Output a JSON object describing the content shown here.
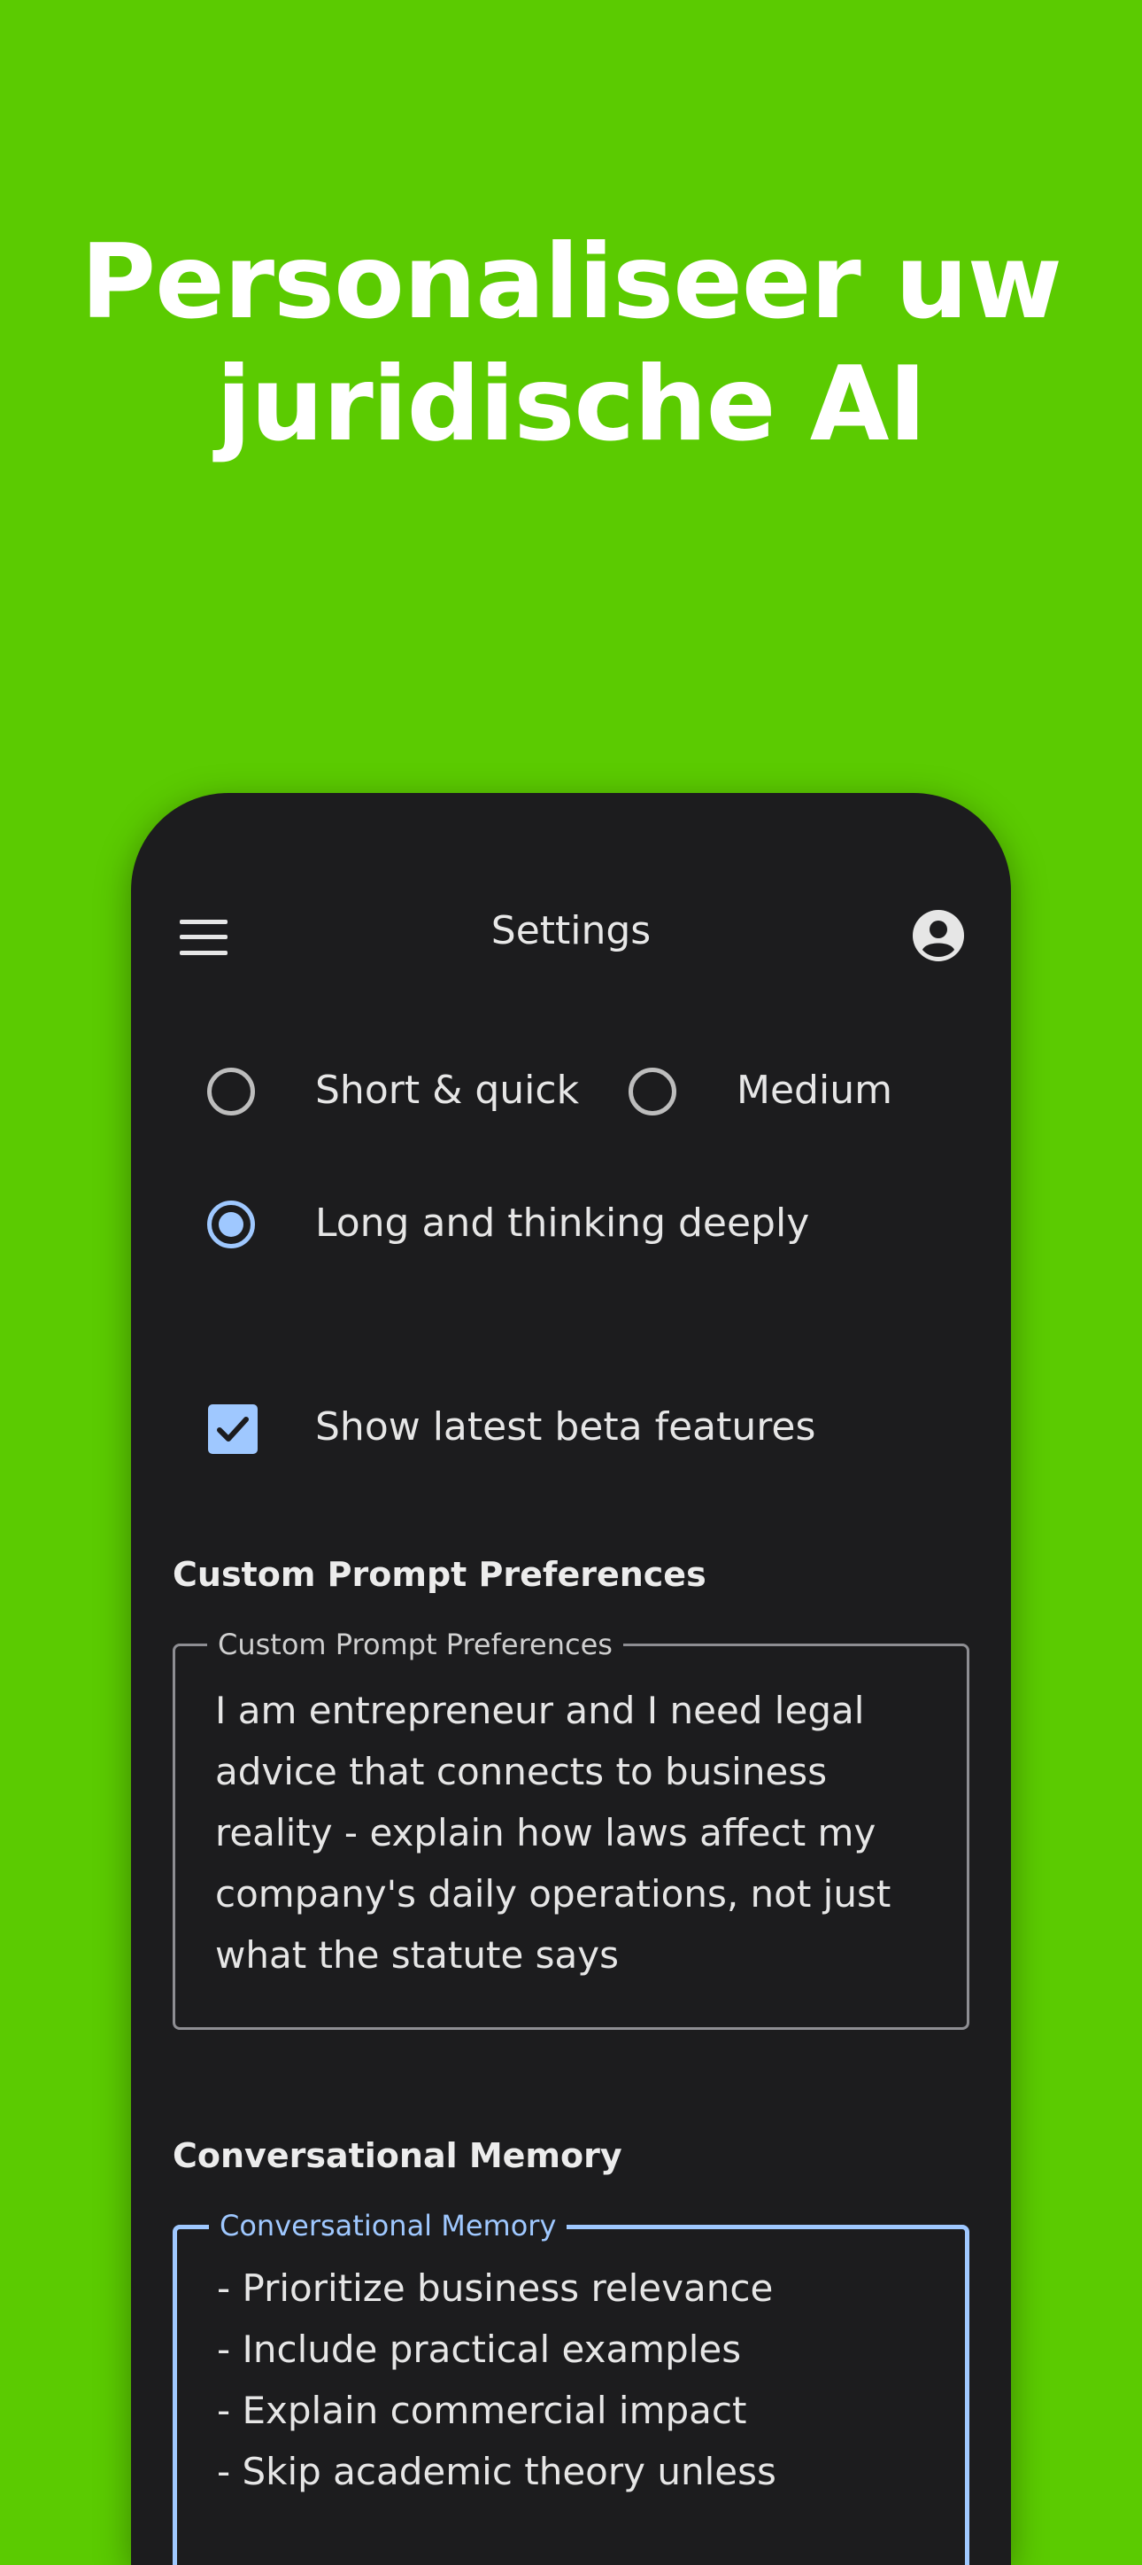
{
  "headline": {
    "line1": "Personaliseer uw",
    "line2": "juridische AI"
  },
  "appbar": {
    "title": "Settings",
    "menu_icon": "menu-icon",
    "account_icon": "account-circle-icon"
  },
  "response_length": {
    "options": [
      {
        "label": "Short & quick",
        "selected": false
      },
      {
        "label": "Medium",
        "selected": false
      },
      {
        "label": "Long and thinking deeply",
        "selected": true
      }
    ]
  },
  "beta": {
    "label": "Show latest beta features",
    "checked": true
  },
  "custom_prompt": {
    "section_title": "Custom Prompt Preferences",
    "field_label": "Custom Prompt Preferences",
    "lines": [
      "I am entrepreneur and I  need legal",
      "advice that connects to business",
      "reality - explain how laws affect my",
      "company's daily operations, not just",
      "what the statute says"
    ]
  },
  "memory": {
    "section_title": "Conversational Memory",
    "field_label": "Conversational Memory",
    "lines": [
      "- Prioritize business relevance",
      "- Include practical examples",
      "- Explain commercial impact",
      "- Skip academic theory unless"
    ]
  },
  "colors": {
    "background": "#5bcb01",
    "surface": "#1c1c1e",
    "accent": "#9fc8ff"
  }
}
